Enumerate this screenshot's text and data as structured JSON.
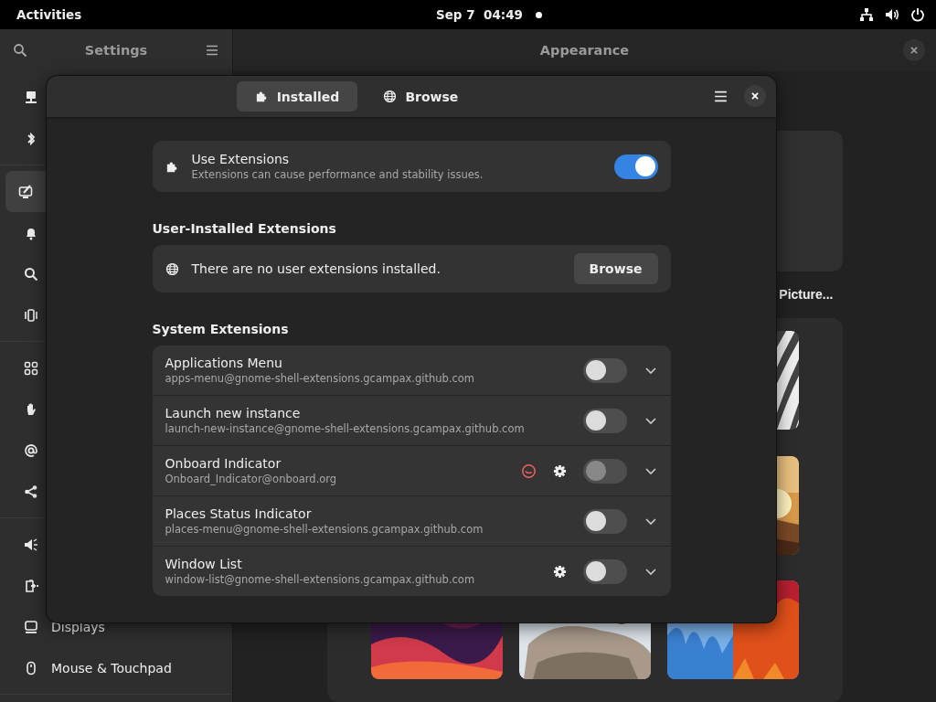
{
  "top_bar": {
    "activities": "Activities",
    "clock": "Sep 7  04:49",
    "notification": true
  },
  "settings_window": {
    "sidebar": {
      "title": "Settings",
      "groups": [
        [
          {
            "selected": false
          },
          {
            "selected": false
          }
        ],
        [
          {
            "selected": true
          },
          {
            "selected": false
          },
          {
            "selected": false
          },
          {
            "selected": false
          }
        ],
        [
          {
            "selected": false
          },
          {
            "selected": false
          },
          {
            "selected": false
          },
          {
            "selected": false
          }
        ],
        [
          {
            "selected": false
          },
          {
            "selected": false
          },
          {
            "label": "Displays",
            "selected": false
          },
          {
            "label": "Mouse & Touchpad",
            "selected": false
          }
        ]
      ]
    },
    "page_title": "Appearance",
    "wallpaper_button": "Picture..."
  },
  "extensions_dialog": {
    "tabs": [
      {
        "label": "Installed",
        "selected": true
      },
      {
        "label": "Browse",
        "selected": false
      }
    ],
    "use_extensions": {
      "title": "Use Extensions",
      "subtitle": "Extensions can cause performance and stability issues.",
      "on": true
    },
    "user_section": {
      "heading": "User-Installed Extensions",
      "empty_text": "There are no user extensions installed.",
      "button": "Browse"
    },
    "system_section": {
      "heading": "System Extensions",
      "extensions": [
        {
          "name": "Applications Menu",
          "uuid": "apps-menu@gnome-shell-extensions.gcampax.github.com",
          "enabled": false,
          "error": false,
          "settings": false
        },
        {
          "name": "Launch new instance",
          "uuid": "launch-new-instance@gnome-shell-extensions.gcampax.github.com",
          "enabled": false,
          "error": false,
          "settings": false
        },
        {
          "name": "Onboard Indicator",
          "uuid": "Onboard_Indicator@onboard.org",
          "enabled": false,
          "error": true,
          "settings": true
        },
        {
          "name": "Places Status Indicator",
          "uuid": "places-menu@gnome-shell-extensions.gcampax.github.com",
          "enabled": false,
          "error": false,
          "settings": false
        },
        {
          "name": "Window List",
          "uuid": "window-list@gnome-shell-extensions.gcampax.github.com",
          "enabled": false,
          "error": false,
          "settings": true
        }
      ]
    }
  }
}
